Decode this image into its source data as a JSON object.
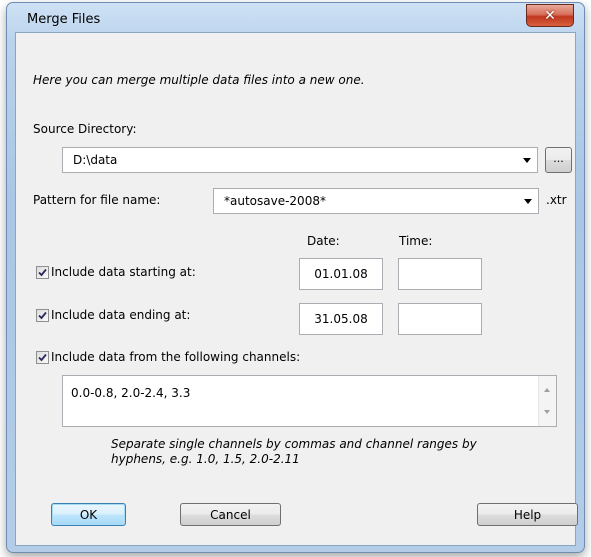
{
  "window": {
    "title": "Merge Files",
    "close_icon": "close-icon"
  },
  "intro": "Here you can merge multiple data files into a new one.",
  "source": {
    "label": "Source Directory:",
    "value": "D:\\data",
    "browse_label": "..."
  },
  "pattern": {
    "label": "Pattern for file name:",
    "value": "*autosave-2008*",
    "suffix": ".xtr"
  },
  "headers": {
    "date": "Date:",
    "time": "Time:"
  },
  "start": {
    "label": "Include data starting at:",
    "checked": true,
    "date": "01.01.08",
    "time": ""
  },
  "end": {
    "label": "Include data ending at:",
    "checked": true,
    "date": "31.05.08",
    "time": ""
  },
  "channels": {
    "label": "Include data from the following channels:",
    "checked": true,
    "value": "0.0-0.8, 2.0-2.4, 3.3",
    "hint_line1": "Separate single channels by commas and channel ranges by",
    "hint_line2": "hyphens, e.g. 1.0, 1.5, 2.0-2.11"
  },
  "buttons": {
    "ok": "OK",
    "cancel": "Cancel",
    "help": "Help"
  },
  "colors": {
    "accent": "#3c7fb1",
    "close": "#c0371f",
    "frame": "#a9c6e6"
  }
}
